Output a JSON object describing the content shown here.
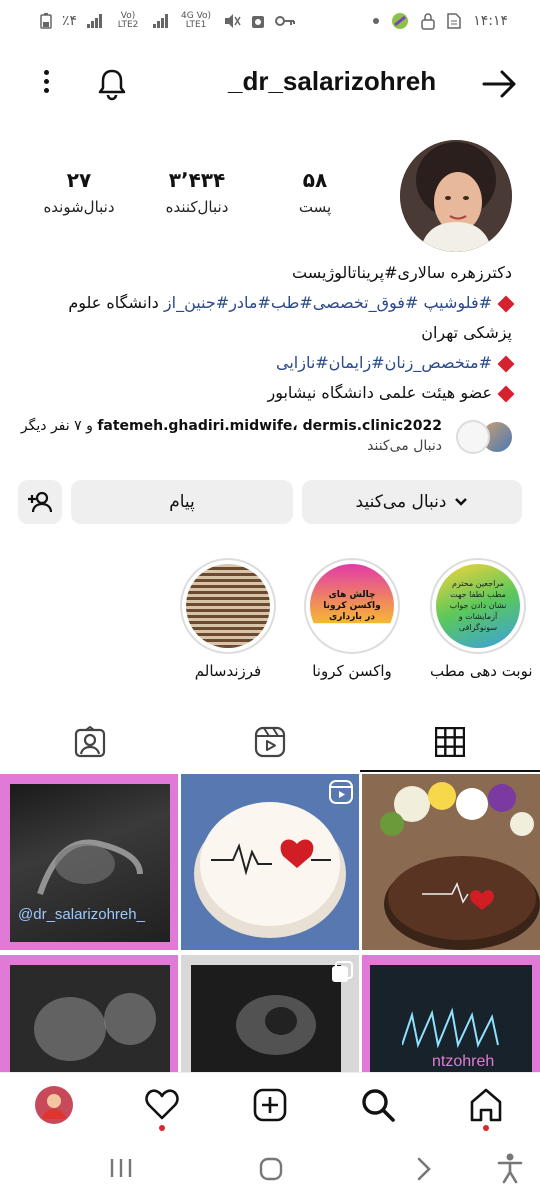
{
  "status_bar": {
    "battery_text": "٪۴",
    "network1": "Vo) LTE2",
    "network2": "4G Vo) LTE1",
    "time": "۱۴:۱۴"
  },
  "header": {
    "username": "_dr_salarizohreh"
  },
  "stats": [
    {
      "value": "۵۸",
      "label": "پست"
    },
    {
      "value": "۳٬۴۳۴",
      "label": "دنبال‌کننده"
    },
    {
      "value": "۲۷",
      "label": "دنبال‌شونده"
    }
  ],
  "bio": {
    "line1": "دکترزهره سالاری#پریناتالوژیست",
    "line2_tag": "#فلوشیپ #فوق_تخصصی#طب#مادر#جنین_از",
    "line2_rest": " دانشگاه علوم",
    "line3": "پزشکی تهران",
    "line4_tag": "#متخصص_زنان#زایمان#نازایی",
    "line5": "عضو هیئت علمی دانشگاه نیشابور"
  },
  "followed_by": {
    "names": "fatemeh.ghadiri.midwife، dermis.clinic2022",
    "suffix": "و ۷ نفر دیگر",
    "label": "دنبال می‌کنند"
  },
  "buttons": {
    "follow": "دنبال می‌کنید",
    "message": "پیام"
  },
  "highlights": [
    {
      "label": "نوبت دهی مطب",
      "inner": "مراجعین محترم مطب لطفا جهت نشان دادن جواب آزمایشات و سونوگرافی"
    },
    {
      "label": "واکسن کرونا",
      "inner": "چالش های واکسن کرونا در بارداری"
    },
    {
      "label": "فرزندسالم",
      "inner": ""
    }
  ],
  "grid": {
    "watermark": "@dr_salarizohreh_",
    "watermark2": "ntzohreh"
  },
  "colors": {
    "accent_red": "#e0242e",
    "tag_blue": "#2a4a8a",
    "button_bg": "#efefef"
  }
}
